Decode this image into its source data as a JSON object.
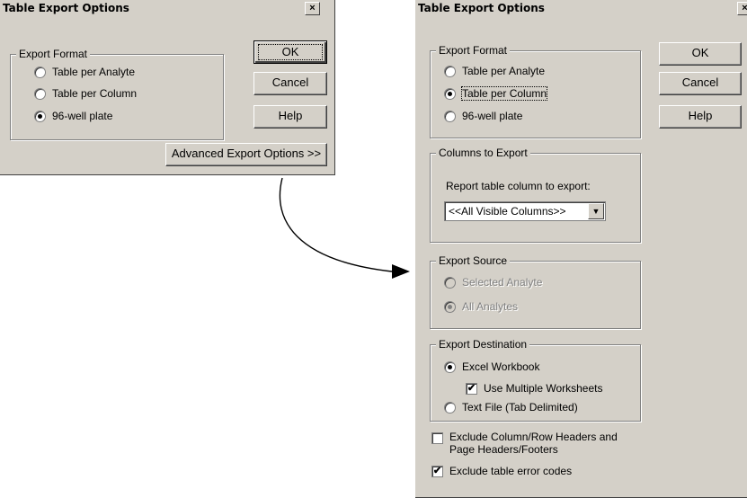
{
  "left_dialog": {
    "title": "Table Export Options",
    "close": "×",
    "export_format": {
      "legend": "Export Format",
      "options": [
        "Table per Analyte",
        "Table per Column",
        "96-well plate"
      ],
      "selected_index": 2
    },
    "buttons": {
      "ok": "OK",
      "cancel": "Cancel",
      "help": "Help",
      "advanced": "Advanced Export Options >>"
    }
  },
  "right_dialog": {
    "title": "Table Export Options",
    "close": "×",
    "export_format": {
      "legend": "Export Format",
      "options": [
        "Table per Analyte",
        "Table per Column",
        "96-well plate"
      ],
      "selected_index": 1
    },
    "buttons": {
      "ok": "OK",
      "cancel": "Cancel",
      "help": "Help"
    },
    "columns_to_export": {
      "legend": "Columns to Export",
      "label": "Report table column to export:",
      "selected": "<<All Visible Columns>>"
    },
    "export_source": {
      "legend": "Export Source",
      "options": [
        "Selected Analyte",
        "All Analytes"
      ],
      "selected_index": 1,
      "disabled": true
    },
    "export_destination": {
      "legend": "Export Destination",
      "excel": "Excel Workbook",
      "multiple_worksheets": "Use Multiple Worksheets",
      "multiple_worksheets_checked": true,
      "text_file": "Text File (Tab Delimited)",
      "selected": "excel"
    },
    "exclude_headers": {
      "label_line1": "Exclude Column/Row Headers and",
      "label_line2": "Page Headers/Footers",
      "checked": false
    },
    "exclude_errors": {
      "label": "Exclude table error codes",
      "checked": true
    }
  },
  "checkmark": "✔",
  "dropdown_arrow": "▼",
  "icons": [
    "close-icon",
    "dropdown-arrow-icon",
    "connector-arrow-icon"
  ]
}
